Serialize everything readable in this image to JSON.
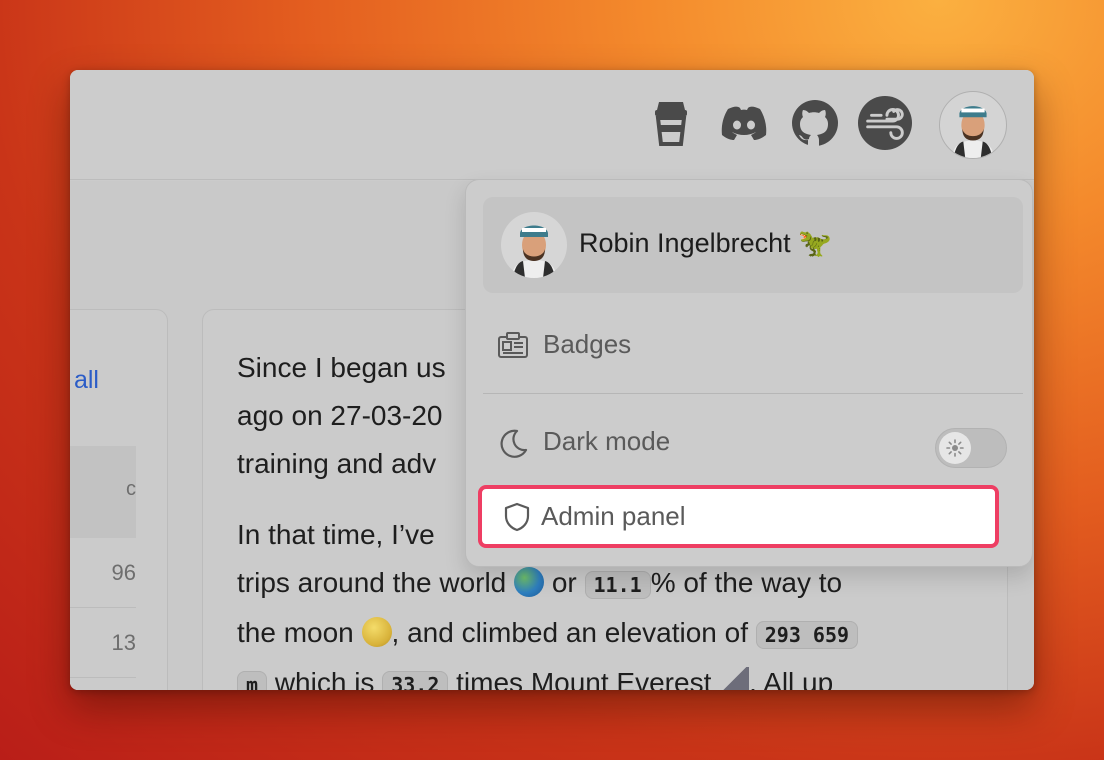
{
  "user": {
    "name": "Robin Ingelbrecht 🦖"
  },
  "header_icons": [
    "cup-icon",
    "discord-icon",
    "github-icon",
    "wind-icon",
    "avatar"
  ],
  "left_card": {
    "view_all_label": "v all",
    "header_fragment": "c",
    "rows": [
      "96",
      "13"
    ]
  },
  "main_card": {
    "para1": [
      "Since I began us",
      "ago on 27-03-20",
      "training and adv"
    ],
    "para2": {
      "line1": "In that time, I’ve",
      "line2_a": "trips around the world",
      "line2_b": "or",
      "line2_code": "11.1",
      "line2_c": "% of the way to",
      "line3_a": "the moon",
      "line3_b": ", and climbed an elevation of",
      "line3_code": "293 659",
      "line4_code": "m",
      "line4_a": "which is",
      "line4_code2": "33.2",
      "line4_b": "times Mount Everest",
      "line4_c": ". All up"
    }
  },
  "menu": {
    "badges_label": "Badges",
    "dark_mode_label": "Dark mode",
    "dark_mode_on": false,
    "admin_label": "Admin panel"
  },
  "colors": {
    "highlight": "#ee3e63",
    "link": "#2b5cc7"
  }
}
